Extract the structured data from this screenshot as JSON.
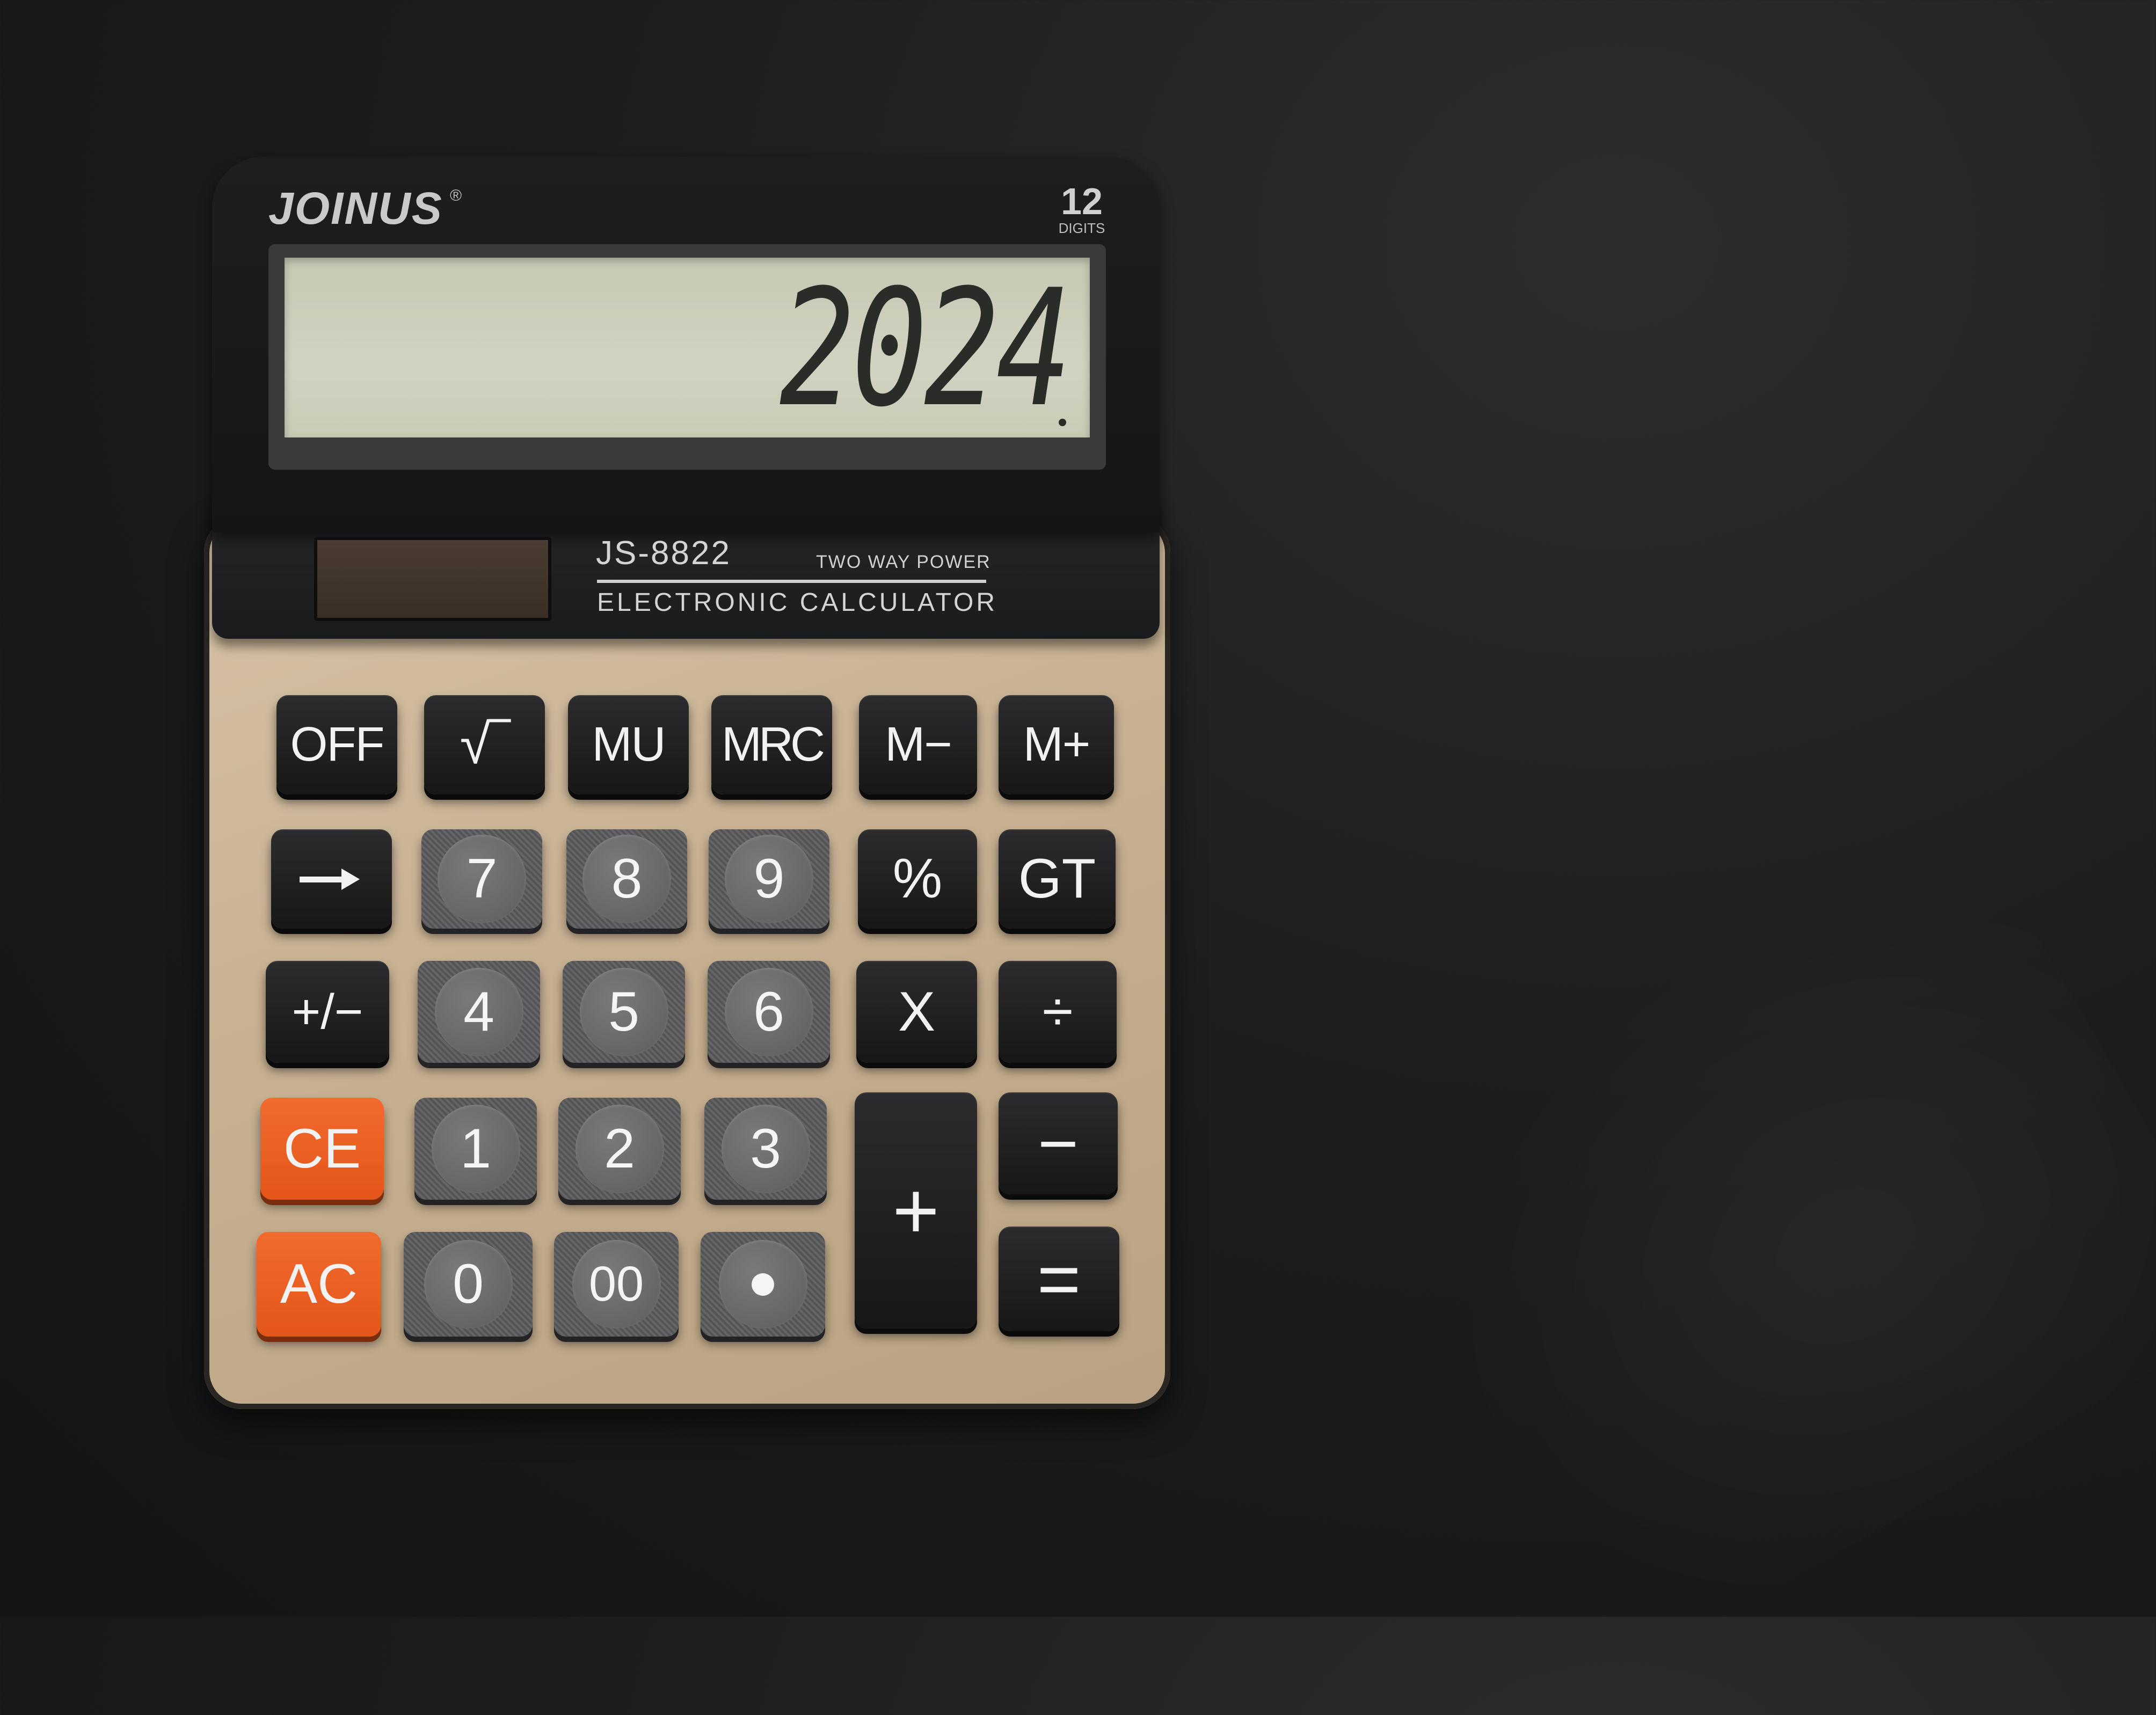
{
  "calculator": {
    "brand": "JOINUS",
    "brand_mark": "®",
    "digits_count": "12",
    "digits_label": "DIGITS",
    "display_value": "2024",
    "model": "JS-8822",
    "power_label": "TWO WAY POWER",
    "subtitle": "ELECTRONIC CALCULATOR",
    "colors": {
      "body": "#c8b293",
      "panel": "#17181a",
      "lcd": "#cfd1bd",
      "key_dark": "#1e1e20",
      "key_orange": "#e85a1c",
      "key_number": "#5f5f62",
      "background": "#1a1b1d"
    }
  },
  "keys": {
    "row1": [
      "OFF",
      "√‾",
      "MU",
      "MRC",
      "M−",
      "M+"
    ],
    "row2": [
      "→",
      "7",
      "8",
      "9",
      "%",
      "GT"
    ],
    "row3": [
      "+/−",
      "4",
      "5",
      "6",
      "X",
      "÷"
    ],
    "row4": [
      "CE",
      "1",
      "2",
      "3",
      "+",
      "−"
    ],
    "row5": [
      "AC",
      "0",
      "00",
      "•",
      "="
    ]
  },
  "icons": {
    "arrow_key": "right-arrow-icon",
    "decimal_key": "dot-icon",
    "solar_panel": "solar-cell-icon"
  }
}
